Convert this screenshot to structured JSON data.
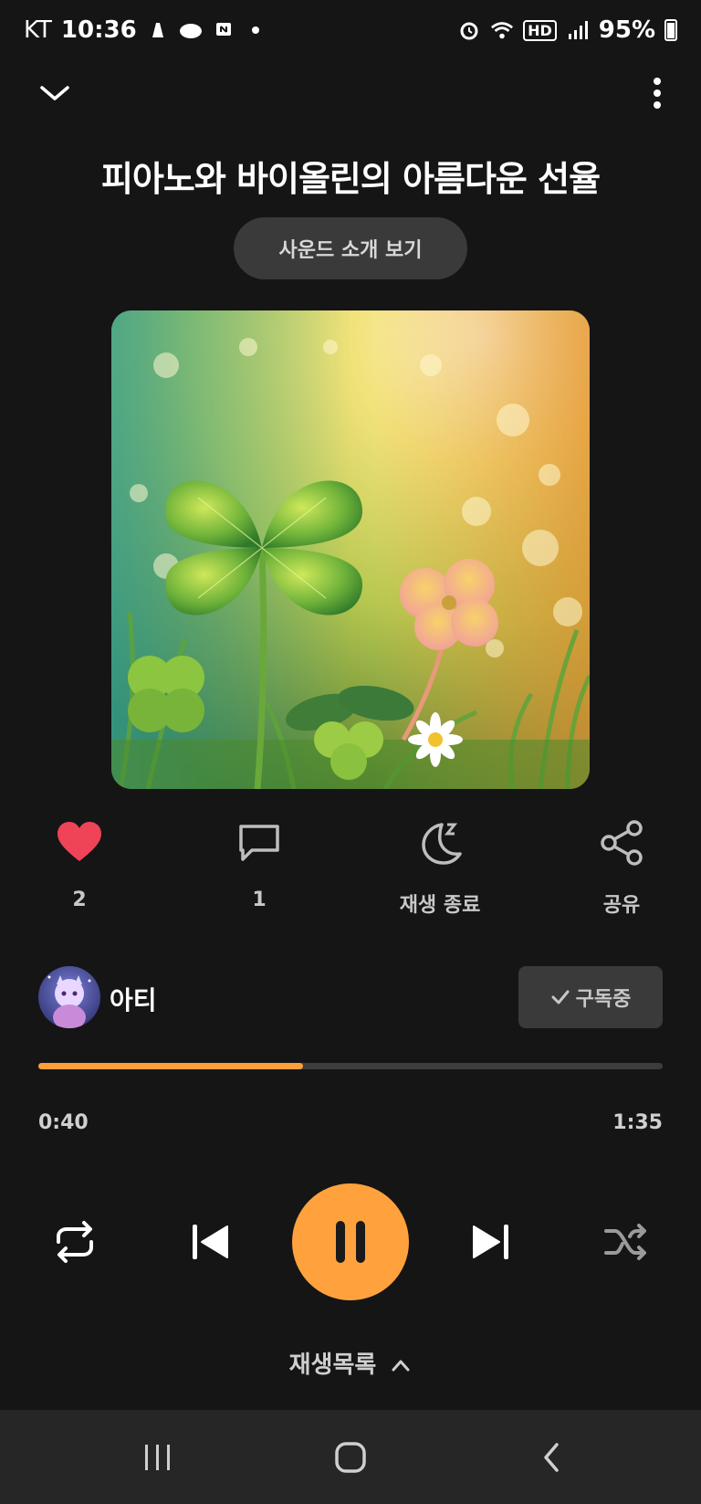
{
  "status_bar": {
    "carrier": "KT",
    "time": "10:36",
    "battery": "95%",
    "network": "HD"
  },
  "track": {
    "title": "피아노와 바이올린의 아름다운 선율",
    "intro_button": "사운드 소개 보기"
  },
  "actions": {
    "like_count": "2",
    "comment_count": "1",
    "sleep_label": "재생 종료",
    "share_label": "공유"
  },
  "artist": {
    "name": "아티",
    "subscribe_label": "구독중"
  },
  "player": {
    "current_time": "0:40",
    "total_time": "1:35",
    "progress_fraction": 0.4246
  },
  "playlist": {
    "label": "재생목록"
  },
  "colors": {
    "accent": "#ffa23d",
    "like": "#ef4358",
    "background": "#151515",
    "button_bg": "#3a3a3a"
  },
  "icons": {
    "collapse": "chevron-down-icon",
    "menu": "more-vertical-icon",
    "like": "heart-icon",
    "comment": "comment-icon",
    "sleep": "moon-icon",
    "share": "share-icon",
    "repeat": "repeat-icon",
    "previous": "skip-previous-icon",
    "pause": "pause-icon",
    "next": "skip-next-icon",
    "shuffle": "shuffle-icon"
  }
}
